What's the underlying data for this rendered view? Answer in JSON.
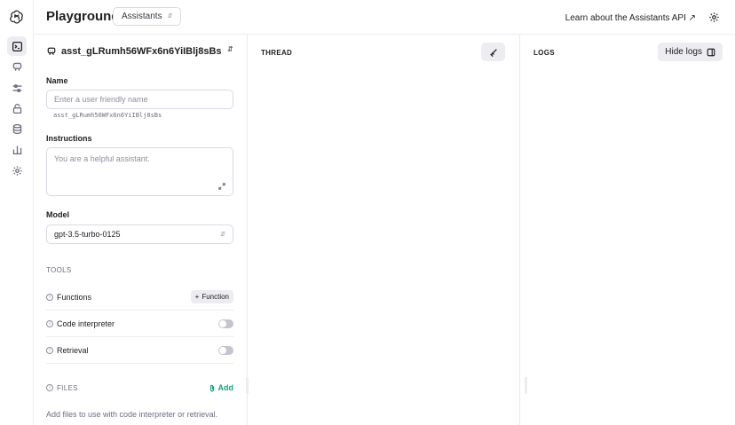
{
  "header": {
    "title": "Playground",
    "mode_select": "Assistants",
    "learn_link": "Learn about the Assistants API ↗"
  },
  "sidebar": {
    "icons": [
      "openai-logo-icon",
      "terminal-icon",
      "assistant-icon",
      "sliders-icon",
      "lock-icon",
      "database-icon",
      "bar-chart-icon",
      "gear-icon"
    ],
    "active": "terminal-icon"
  },
  "assistant": {
    "id": "asst_gLRumh56WFx6n6YiIBlj8sBs",
    "name_label": "Name",
    "name_placeholder": "Enter a user friendly name",
    "id_caption": "asst_gLRumh56WFx6n6YiIBlj8sBs",
    "instructions_label": "Instructions",
    "instructions_placeholder": "You are a helpful assistant.",
    "model_label": "Model",
    "model_value": "gpt-3.5-turbo-0125",
    "tools_caption": "TOOLS",
    "tools": [
      {
        "label": "Functions",
        "action": "Function"
      },
      {
        "label": "Code interpreter",
        "enabled": false
      },
      {
        "label": "Retrieval",
        "enabled": false
      }
    ],
    "files_caption": "FILES",
    "files_add": "Add",
    "files_hint": "Add files to use with code interpreter or retrieval."
  },
  "thread": {
    "title": "THREAD"
  },
  "logs": {
    "title": "LOGS",
    "hide_button": "Hide logs"
  },
  "colors": {
    "accent": "#10a37f",
    "border": "#ececf1",
    "text": "#202123"
  }
}
